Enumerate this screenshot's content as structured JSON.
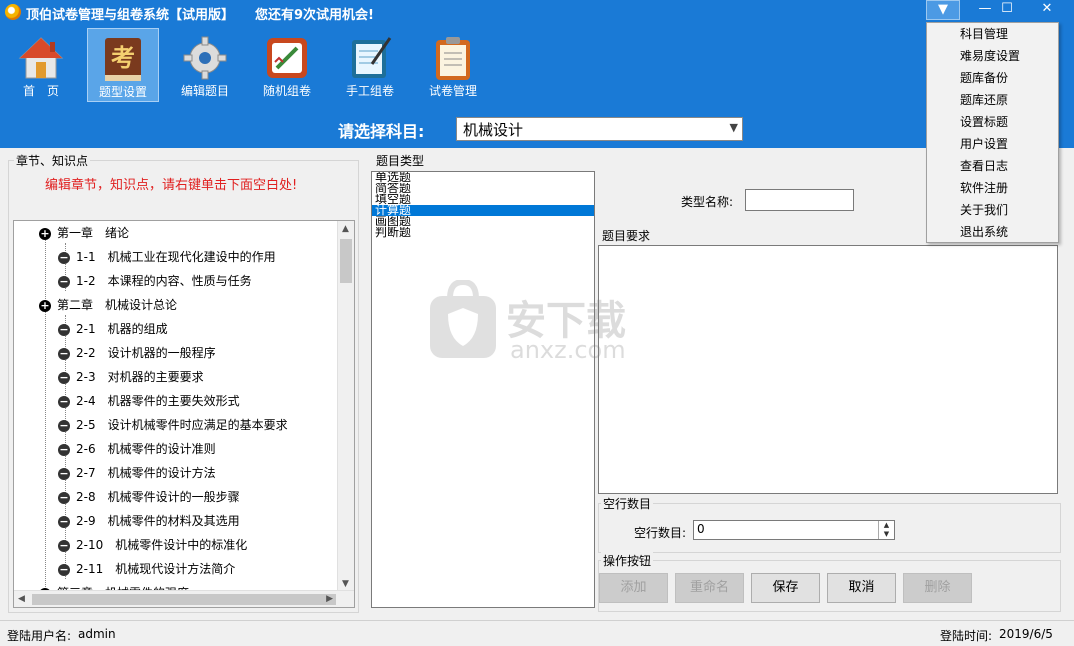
{
  "app": {
    "title": "顶伯试卷管理与组卷系统【试用版】",
    "trial_notice": "您还有9次试用机会!"
  },
  "window_controls": {
    "dropdown": "▼",
    "minimize": "—",
    "maximize": "☐",
    "close": "✕"
  },
  "toolbar": {
    "items": [
      {
        "label": "首　页",
        "icon": "home-icon"
      },
      {
        "label": "题型设置",
        "icon": "book-icon",
        "active": true
      },
      {
        "label": "编辑题目",
        "icon": "gear-icon"
      },
      {
        "label": "随机组卷",
        "icon": "pencil-paper-icon"
      },
      {
        "label": "手工组卷",
        "icon": "notebook-pen-icon"
      },
      {
        "label": "试卷管理",
        "icon": "clipboard-icon"
      }
    ],
    "subject_label": "请选择科目:",
    "subject_value": "机械设计"
  },
  "left_panel": {
    "group_title": "章节、知识点",
    "hint": "编辑章节，知识点，请右键单击下面空白处!",
    "tree": [
      {
        "level": 0,
        "node": "plus",
        "label": "第一章　绪论"
      },
      {
        "level": 1,
        "node": "minus",
        "label": "1-1　机械工业在现代化建设中的作用"
      },
      {
        "level": 1,
        "node": "minus",
        "label": "1-2　本课程的内容、性质与任务"
      },
      {
        "level": 0,
        "node": "plus",
        "label": "第二章　机械设计总论"
      },
      {
        "level": 1,
        "node": "minus",
        "label": "2-1　机器的组成"
      },
      {
        "level": 1,
        "node": "minus",
        "label": "2-2　设计机器的一般程序"
      },
      {
        "level": 1,
        "node": "minus",
        "label": "2-3　对机器的主要要求"
      },
      {
        "level": 1,
        "node": "minus",
        "label": "2-4　机器零件的主要失效形式"
      },
      {
        "level": 1,
        "node": "minus",
        "label": "2-5　设计机械零件时应满足的基本要求"
      },
      {
        "level": 1,
        "node": "minus",
        "label": "2-6　机械零件的设计准则"
      },
      {
        "level": 1,
        "node": "minus",
        "label": "2-7　机械零件的设计方法"
      },
      {
        "level": 1,
        "node": "minus",
        "label": "2-8　机械零件设计的一般步骤"
      },
      {
        "level": 1,
        "node": "minus",
        "label": "2-9　机械零件的材料及其选用"
      },
      {
        "level": 1,
        "node": "minus",
        "label": "2-10　机械零件设计中的标准化"
      },
      {
        "level": 1,
        "node": "minus",
        "label": "2-11　机械现代设计方法简介"
      },
      {
        "level": 0,
        "node": "plus",
        "label": "第三章　机械零件的强度"
      }
    ]
  },
  "type_panel": {
    "group_title": "题目类型",
    "items": [
      "单选题",
      "简答题",
      "填空题",
      "计算题",
      "画图题",
      "判断题"
    ],
    "selected_index": 3
  },
  "detail": {
    "type_name_label": "类型名称:",
    "type_name_value": "",
    "requirement_title": "题目要求",
    "requirement_value": "",
    "blank_group_title": "空行数目",
    "blank_label": "空行数目:",
    "blank_value": "0",
    "ops_title": "操作按钮",
    "buttons": [
      {
        "label": "添加",
        "enabled": false
      },
      {
        "label": "重命名",
        "enabled": false
      },
      {
        "label": "保存",
        "enabled": true
      },
      {
        "label": "取消",
        "enabled": true
      },
      {
        "label": "删除",
        "enabled": false
      }
    ]
  },
  "menu": {
    "items": [
      "科目管理",
      "难易度设置",
      "题库备份",
      "题库还原",
      "设置标题",
      "用户设置",
      "查看日志",
      "软件注册",
      "关于我们",
      "退出系统"
    ]
  },
  "status": {
    "user_label": "登陆用户名:",
    "user_value": "admin",
    "time_label": "登陆时间:",
    "time_value": "2019/6/5"
  },
  "watermark": {
    "text": "安下载",
    "sub": "anxz.com"
  }
}
